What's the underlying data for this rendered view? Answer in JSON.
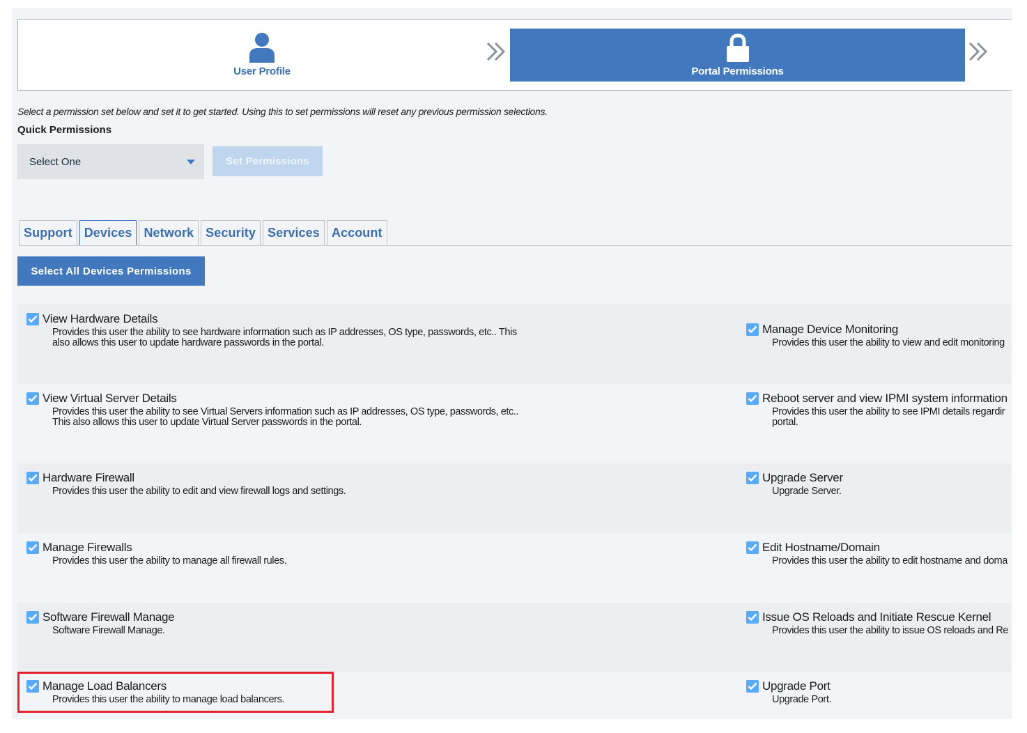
{
  "wizard": {
    "steps": [
      {
        "label": "User Profile",
        "icon": "user-icon"
      },
      {
        "label": "Portal Permissions",
        "icon": "lock-icon"
      }
    ]
  },
  "intro_text": "Select a permission set below and set it to get started. Using this to set permissions will reset any previous permission selections.",
  "quick_permissions": {
    "title": "Quick Permissions",
    "select_value": "Select One",
    "set_button": "Set Permissions"
  },
  "tabs": [
    "Support",
    "Devices",
    "Network",
    "Security",
    "Services",
    "Account"
  ],
  "active_tab": "Devices",
  "select_all_button": "Select All Devices Permissions",
  "permissions": {
    "left": [
      {
        "title": "View Hardware Details",
        "desc": "Provides this user the ability to see hardware information such as IP addresses, OS type, passwords, etc.. This\nalso allows this user to update hardware passwords in the portal.",
        "checked": true
      },
      {
        "title": "View Virtual Server Details",
        "desc": "Provides this user the ability to see Virtual Servers information such as IP addresses, OS type, passwords, etc..\nThis also allows this user to update Virtual Server passwords in the portal.",
        "checked": true
      },
      {
        "title": "Hardware Firewall",
        "desc": "Provides this user the ability to edit and view firewall logs and settings.",
        "checked": true
      },
      {
        "title": "Manage Firewalls",
        "desc": "Provides this user the ability to manage all firewall rules.",
        "checked": true
      },
      {
        "title": "Software Firewall Manage",
        "desc": "Software Firewall Manage.",
        "checked": true
      },
      {
        "title": "Manage Load Balancers",
        "desc": "Provides this user the ability to manage load balancers.",
        "checked": true
      }
    ],
    "right": [
      {
        "title": "Manage Device Monitoring",
        "desc": "Provides this user the ability to view and edit monitoring",
        "checked": true
      },
      {
        "title": "Reboot server and view IPMI system information",
        "desc": "Provides this user the ability to see IPMI details regardir\nportal.",
        "checked": true
      },
      {
        "title": "Upgrade Server",
        "desc": "Upgrade Server.",
        "checked": true
      },
      {
        "title": "Edit Hostname/Domain",
        "desc": "Provides this user the ability to edit hostname and doma",
        "checked": true
      },
      {
        "title": "Issue OS Reloads and Initiate Rescue Kernel",
        "desc": "Provides this user the ability to issue OS reloads and Re",
        "checked": true
      },
      {
        "title": "Upgrade Port",
        "desc": "Upgrade Port.",
        "checked": true
      }
    ]
  },
  "colors": {
    "primary": "#4178be",
    "checkbox": "#5aaafa",
    "highlight": "#e2232f",
    "disabled_button": "#c0d6ee"
  }
}
